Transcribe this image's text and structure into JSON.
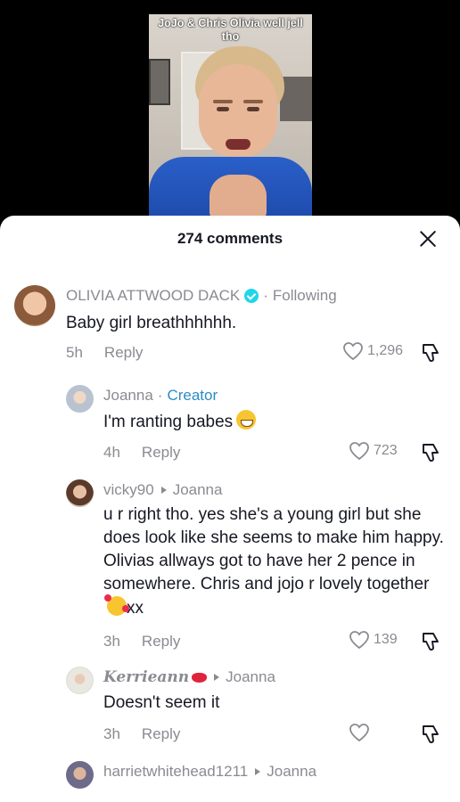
{
  "video": {
    "caption": "JoJo & Chris Olivia well jell tho"
  },
  "sheet": {
    "title": "274 comments"
  },
  "comments": [
    {
      "author": "OLIVIA ATTWOOD DACK",
      "follow_status": "Following",
      "text": "Baby girl breathhhhhh.",
      "time": "5h",
      "reply": "Reply",
      "likes": "1,296"
    },
    {
      "author": "Joanna",
      "badge": "Creator",
      "text": "I'm ranting babes",
      "time": "4h",
      "reply": "Reply",
      "likes": "723"
    },
    {
      "author": "vicky90",
      "reply_to": "Joanna",
      "text": "u r right tho. yes she's a young girl but she does look like she seems to make him happy. Olivias allways got to have her 2 pence in somewhere. Chris and jojo r lovely together",
      "text_suffix": "xx",
      "time": "3h",
      "reply": "Reply",
      "likes": "139"
    },
    {
      "author": "Kerrieann",
      "reply_to": "Joanna",
      "text": "Doesn't seem it",
      "time": "3h",
      "reply": "Reply",
      "likes": ""
    },
    {
      "author": "harrietwhitehead1211",
      "reply_to": "Joanna"
    }
  ]
}
